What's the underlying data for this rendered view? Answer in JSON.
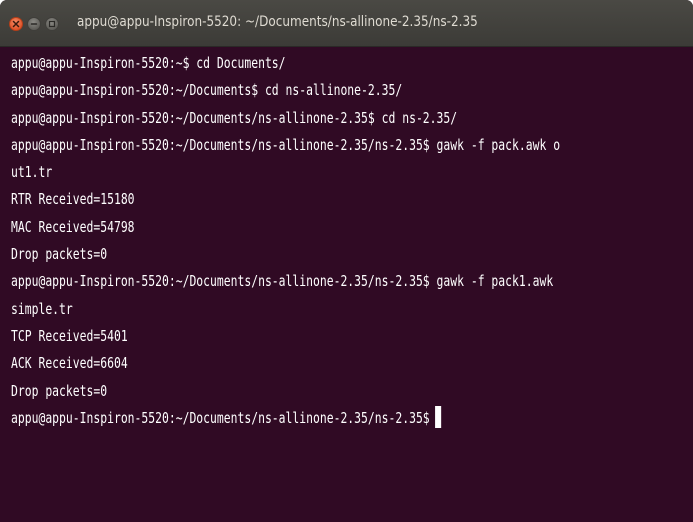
{
  "window": {
    "title": "appu@appu-Inspiron-5520: ~/Documents/ns-allinone-2.35/ns-2.35"
  },
  "terminal": {
    "lines": [
      "appu@appu-Inspiron-5520:~$ cd Documents/",
      "appu@appu-Inspiron-5520:~/Documents$ cd ns-allinone-2.35/",
      "appu@appu-Inspiron-5520:~/Documents/ns-allinone-2.35$ cd ns-2.35/",
      "appu@appu-Inspiron-5520:~/Documents/ns-allinone-2.35/ns-2.35$ gawk -f pack.awk o",
      "ut1.tr",
      "RTR Received=15180",
      "MAC Received=54798",
      "Drop packets=0",
      "appu@appu-Inspiron-5520:~/Documents/ns-allinone-2.35/ns-2.35$ gawk -f pack1.awk",
      "simple.tr",
      "TCP Received=5401",
      "ACK Received=6604",
      "Drop packets=0"
    ],
    "prompt": "appu@appu-Inspiron-5520:~/Documents/ns-allinone-2.35/ns-2.35$"
  },
  "colors": {
    "terminal_background": "#300a24",
    "titlebar_background": "#3c3b37",
    "text": "#ffffff",
    "close_button": "#e0542a"
  },
  "icons": {
    "close": "close-icon",
    "minimize": "minimize-icon",
    "maximize": "maximize-icon"
  }
}
